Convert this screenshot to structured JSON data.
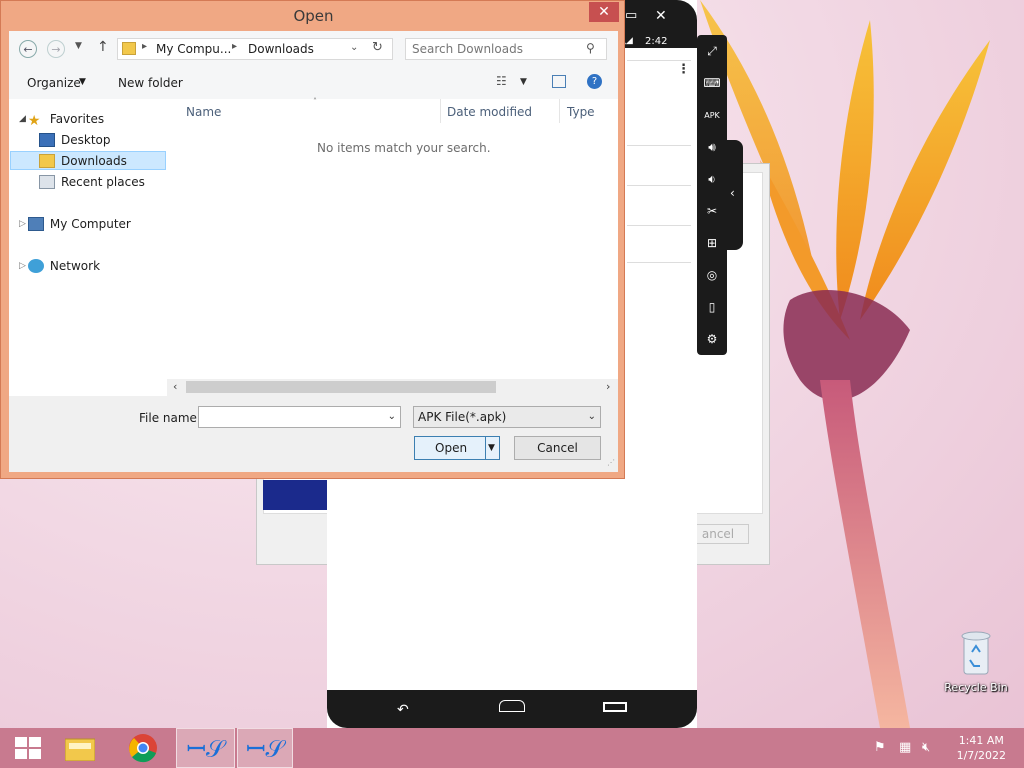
{
  "dialog": {
    "title": "Open",
    "close_glyph": "✕",
    "address": {
      "crumb1": "My Compu...",
      "crumb2": "Downloads",
      "search_placeholder": "Search Downloads"
    },
    "toolbar": {
      "organize": "Organize",
      "new_folder": "New folder"
    },
    "nav": {
      "favorites": "Favorites",
      "desktop": "Desktop",
      "downloads": "Downloads",
      "recent": "Recent places",
      "my_computer": "My Computer",
      "network": "Network"
    },
    "columns": {
      "name": "Name",
      "date": "Date modified",
      "type": "Type"
    },
    "empty_message": "No items match your search.",
    "file_name_label": "File name:",
    "file_name_value": "",
    "file_type": "APK File(*.apk)",
    "open_button": "Open",
    "cancel_button": "Cancel"
  },
  "emulator": {
    "status_time": "2:42",
    "bg_cancel_text": "ancel"
  },
  "desktop": {
    "recycle_bin": "Recycle Bin"
  },
  "taskbar": {
    "time": "1:41 AM",
    "date": "1/7/2022"
  },
  "colors": {
    "dialog_frame": "#f0a884",
    "close_button": "#c75050",
    "taskbar": "#c87a8f",
    "selection": "#cce8ff"
  }
}
